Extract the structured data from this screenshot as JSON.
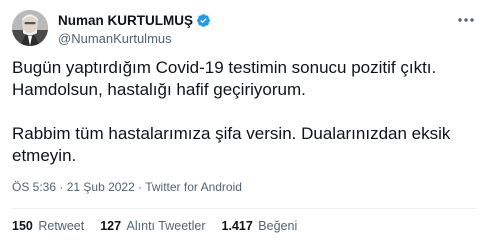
{
  "author": {
    "display_name": "Numan KURTULMUŞ",
    "handle": "@NumanKurtulmus",
    "verified_icon": "verified-badge-icon",
    "accent_color": "#1d9bf0"
  },
  "tweet": {
    "paragraphs": [
      "Bugün yaptırdığım Covid-19 testimin sonucu pozitif çıktı. Hamdolsun, hastalığı hafif geçiriyorum.",
      "Rabbim tüm hastalarımıza şifa versin. Dualarınızdan eksik etmeyin."
    ],
    "time": "ÖS 5:36",
    "separator": " · ",
    "date": "21 Şub 2022",
    "source": "Twitter for Android"
  },
  "stats": {
    "retweets_count": "150",
    "retweets_label": "Retweet",
    "quotes_count": "127",
    "quotes_label": "Alıntı Tweetler",
    "likes_count": "1.417",
    "likes_label": "Beğeni"
  }
}
